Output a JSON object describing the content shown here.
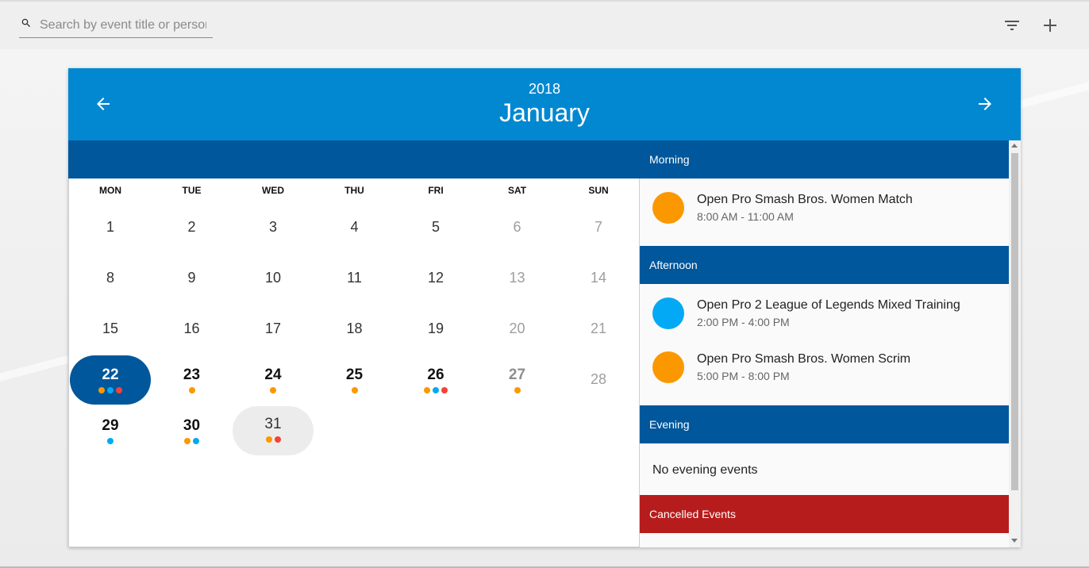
{
  "search": {
    "placeholder": "Search by event title or person"
  },
  "icons": {
    "search": "search-icon",
    "filter": "filter-icon",
    "add": "plus-icon",
    "prev": "arrow-left-icon",
    "next": "arrow-right-icon"
  },
  "colors": {
    "header": "#0288d1",
    "dark_blue": "#01579b",
    "cancelled": "#b71c1c",
    "orange": "#fb9800",
    "light_blue": "#03a9f4",
    "red": "#f44336"
  },
  "calendar": {
    "year": "2018",
    "month": "January",
    "weekdays": [
      "MON",
      "TUE",
      "WED",
      "THU",
      "FRI",
      "SAT",
      "SUN"
    ],
    "days": [
      {
        "n": "1"
      },
      {
        "n": "2"
      },
      {
        "n": "3"
      },
      {
        "n": "4"
      },
      {
        "n": "5"
      },
      {
        "n": "6"
      },
      {
        "n": "7"
      },
      {
        "n": "8"
      },
      {
        "n": "9"
      },
      {
        "n": "10"
      },
      {
        "n": "11"
      },
      {
        "n": "12"
      },
      {
        "n": "13"
      },
      {
        "n": "14"
      },
      {
        "n": "15"
      },
      {
        "n": "16"
      },
      {
        "n": "17"
      },
      {
        "n": "18"
      },
      {
        "n": "19"
      },
      {
        "n": "20"
      },
      {
        "n": "21"
      },
      {
        "n": "22",
        "selected": true,
        "dots": [
          "orange",
          "light_blue",
          "red"
        ]
      },
      {
        "n": "23",
        "dots": [
          "orange"
        ]
      },
      {
        "n": "24",
        "dots": [
          "orange"
        ]
      },
      {
        "n": "25",
        "dots": [
          "orange"
        ]
      },
      {
        "n": "26",
        "dots": [
          "orange",
          "light_blue",
          "red"
        ]
      },
      {
        "n": "27",
        "dots": [
          "orange"
        ]
      },
      {
        "n": "28"
      },
      {
        "n": "29",
        "dots": [
          "light_blue"
        ]
      },
      {
        "n": "30",
        "dots": [
          "orange",
          "light_blue"
        ]
      },
      {
        "n": "31",
        "today": true,
        "dots": [
          "orange",
          "red"
        ]
      }
    ]
  },
  "agenda": {
    "morning": {
      "label": "Morning",
      "events": [
        {
          "title": "Open Pro Smash Bros. Women Match",
          "time": "8:00 AM - 11:00 AM",
          "color": "orange"
        }
      ]
    },
    "afternoon": {
      "label": "Afternoon",
      "events": [
        {
          "title": "Open Pro 2 League of Legends Mixed Training",
          "time": "2:00 PM - 4:00 PM",
          "color": "light_blue"
        },
        {
          "title": "Open Pro Smash Bros. Women Scrim",
          "time": "5:00 PM - 8:00 PM",
          "color": "orange"
        }
      ]
    },
    "evening": {
      "label": "Evening",
      "empty_text": "No evening events"
    },
    "cancelled": {
      "label": "Cancelled Events"
    }
  }
}
